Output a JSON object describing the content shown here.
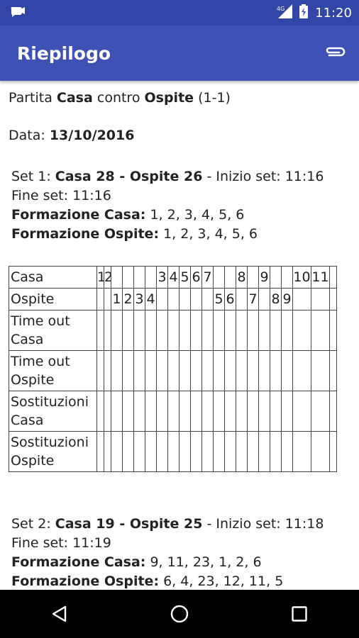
{
  "status_bar": {
    "time": "11:20",
    "icons": [
      "app-notification-icon",
      "signal-4g-icon",
      "battery-icon"
    ]
  },
  "app_bar": {
    "title": "Riepilogo",
    "action_icon": "paperclip-icon"
  },
  "summary": {
    "match_prefix": "Partita ",
    "home_team": "Casa",
    "vs": " contro ",
    "away_team": "Ospite",
    "score": " (1-1)",
    "date_label": "Data: ",
    "date_value": "13/10/2016"
  },
  "sets": [
    {
      "set_label": "Set 1: ",
      "score_text": "Casa 28 - Ospite 26",
      "start_label": " - Inizio set: ",
      "start_time": "11:16",
      "end_label": "Fine set: ",
      "end_time": "11:16",
      "home_lineup_label": "Formazione Casa:",
      "home_lineup": " 1, 2, 3, 4, 5, 6",
      "away_lineup_label": "Formazione Ospite:",
      "away_lineup": " 1, 2, 3, 4, 5, 6"
    },
    {
      "set_label": "Set 2: ",
      "score_text": "Casa 19 - Ospite 25",
      "start_label": " - Inizio set: ",
      "start_time": "11:18",
      "end_label": "Fine set: ",
      "end_time": "11:19",
      "home_lineup_label": "Formazione Casa:",
      "home_lineup": " 9, 11, 23, 1, 2, 6",
      "away_lineup_label": "Formazione Ospite:",
      "away_lineup": " 6, 4, 23, 12, 11, 5"
    }
  ],
  "score_sheet": {
    "rows": [
      {
        "label": "Casa",
        "cells": [
          "1",
          "2",
          "",
          "",
          "",
          "",
          "3",
          "4",
          "5",
          "6",
          "7",
          "",
          "",
          "8",
          "",
          "9",
          "",
          "",
          "10",
          "11",
          ""
        ]
      },
      {
        "label": "Ospite",
        "cells": [
          "",
          "",
          "1",
          "2",
          "3",
          "4",
          "",
          "",
          "",
          "",
          "",
          "5",
          "6",
          "",
          "7",
          "",
          "8",
          "9",
          "",
          "",
          ""
        ]
      },
      {
        "label": "Time out Casa",
        "cells": [
          "",
          "",
          "",
          "",
          "",
          "",
          "",
          "",
          "",
          "",
          "",
          "",
          "",
          "",
          "",
          "",
          "",
          "",
          "",
          "",
          ""
        ]
      },
      {
        "label": "Time out Ospite",
        "cells": [
          "",
          "",
          "",
          "",
          "",
          "",
          "",
          "",
          "",
          "",
          "",
          "",
          "",
          "",
          "",
          "",
          "",
          "",
          "",
          "",
          ""
        ]
      },
      {
        "label": "Sostituzioni Casa",
        "cells": [
          "",
          "",
          "",
          "",
          "",
          "",
          "",
          "",
          "",
          "",
          "",
          "",
          "",
          "",
          "",
          "",
          "",
          "",
          "",
          "",
          ""
        ]
      },
      {
        "label": "Sostituzioni Ospite",
        "cells": [
          "",
          "",
          "",
          "",
          "",
          "",
          "",
          "",
          "",
          "",
          "",
          "",
          "",
          "",
          "",
          "",
          "",
          "",
          "",
          "",
          ""
        ]
      }
    ]
  },
  "nav_bar": {
    "buttons": [
      "back-icon",
      "home-icon",
      "recents-icon"
    ]
  }
}
